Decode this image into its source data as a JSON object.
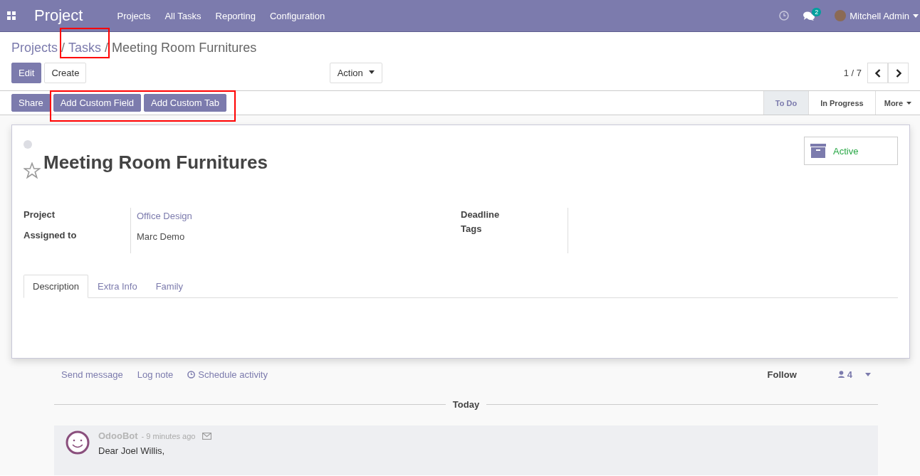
{
  "navbar": {
    "app_title": "Project",
    "menu": [
      "Projects",
      "All Tasks",
      "Reporting",
      "Configuration"
    ],
    "messages_badge": "2",
    "user": "Mitchell Admin"
  },
  "breadcrumbs": [
    {
      "label": "Projects",
      "link": true,
      "highlighted": false
    },
    {
      "separator": "/",
      "label": "Tasks",
      "link": true,
      "highlighted": true
    },
    {
      "separator": "/",
      "label": "Meeting Room Furnitures",
      "link": false,
      "highlighted": false
    }
  ],
  "buttons": {
    "edit": "Edit",
    "create": "Create",
    "action": "Action"
  },
  "pager": "1 / 7",
  "header_buttons": [
    {
      "label": "Share",
      "kind": "share"
    },
    {
      "label": "Add Custom Field",
      "kind": "custom"
    },
    {
      "label": "Add Custom Tab",
      "kind": "custom"
    }
  ],
  "custom_group_highlighted": true,
  "stages": [
    {
      "label": "To Do",
      "selected": true
    },
    {
      "label": "In Progress",
      "selected": false
    }
  ],
  "stages_more": "More",
  "record": {
    "title": "Meeting Room Furnitures",
    "starred": false,
    "active_label": "Active",
    "left_fields": [
      {
        "label": "Project",
        "value": "Office Design",
        "link": true
      },
      {
        "label": "Assigned to",
        "value": "Marc Demo",
        "link": false
      }
    ],
    "right_fields": [
      {
        "label": "Deadline"
      },
      {
        "label": "Tags"
      }
    ],
    "tabs": [
      {
        "label": "Description",
        "selected": true
      },
      {
        "label": "Extra Info",
        "selected": false
      },
      {
        "label": "Family",
        "selected": false
      }
    ]
  },
  "chatter": {
    "actions": [
      "Send message",
      "Log note",
      "Schedule activity"
    ],
    "follow": "Follow",
    "followers": "4",
    "separator": "Today",
    "message": {
      "author": "OdooBot",
      "time": "- 9 minutes ago",
      "body": "Dear Joel Willis,"
    }
  }
}
